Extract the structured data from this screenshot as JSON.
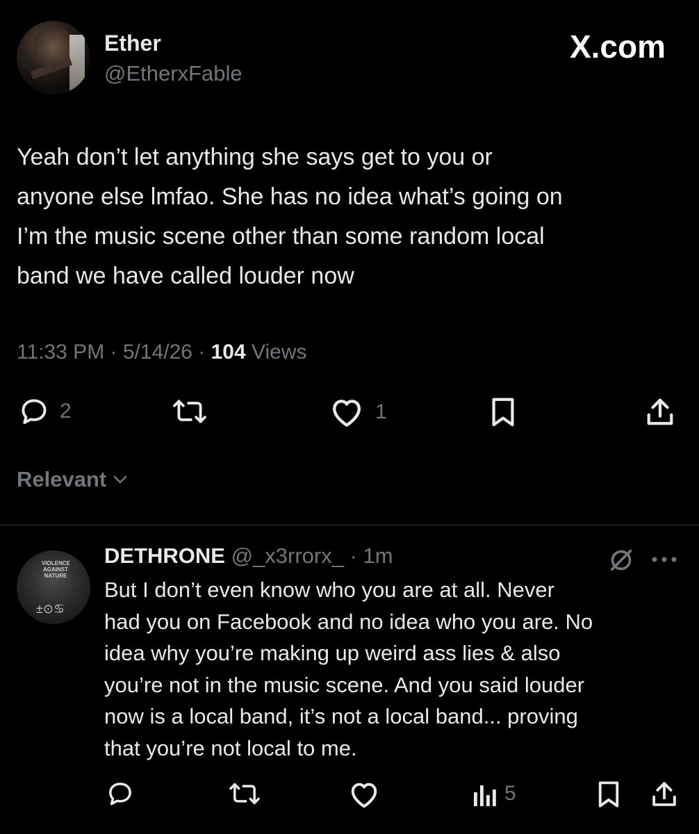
{
  "header": {
    "site_label": "X.com"
  },
  "tweet": {
    "author_name": "Ether",
    "author_handle": "@EtherxFable",
    "text": "Yeah don’t let anything she says get to you or\nanyone else lmfao. She has no idea what’s going on\nI’m the music scene other than some random local\nband we have called louder now",
    "time": "11:33 PM",
    "date": "5/14/26",
    "views_count": "104",
    "views_label": "Views",
    "reply_count": "2",
    "like_count": "1"
  },
  "filter": {
    "label": "Relevant"
  },
  "reply": {
    "author_name": "DETHRONE",
    "author_handle": "@_x3rrorx_",
    "age": "1m",
    "avatar_text": "VIOLENCE AGAINST NATURE",
    "text": "But I don’t even know who you are at all. Never\nhad you on Facebook and no idea who you are. No\nidea why you’re making up weird ass lies & also\nyou’re not in the music scene. And you said louder\nnow is a local band,  it’s not a local band... proving\nthat you’re not local to me.",
    "views_count": "5"
  },
  "icons": {
    "reply": "reply-icon",
    "repost": "repost-icon",
    "like": "heart-icon",
    "bookmark": "bookmark-icon",
    "share": "share-icon",
    "views": "views-icon",
    "grok": "grok-icon",
    "more": "more-icon",
    "chevron": "chevron-down-icon"
  },
  "colors": {
    "background": "#000000",
    "text": "#e7e9ea",
    "muted": "#71767b",
    "divider": "#2f3336"
  }
}
